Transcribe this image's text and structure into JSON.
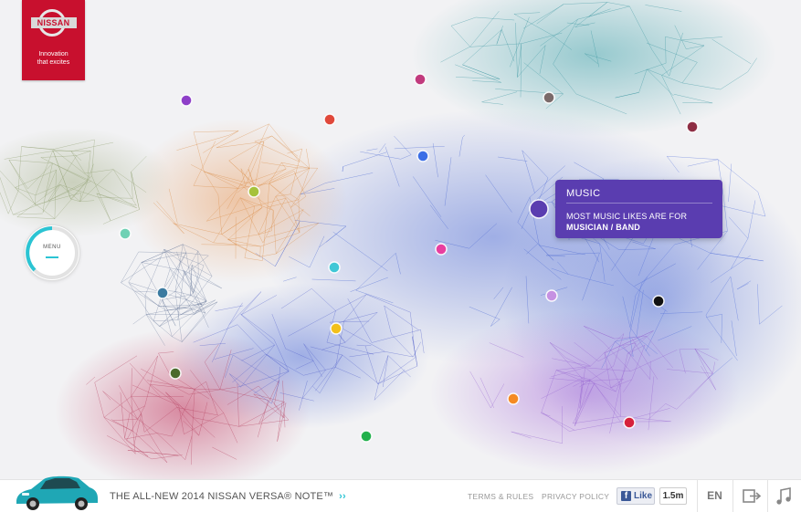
{
  "brand": {
    "name": "NISSAN",
    "tagline_line1": "Innovation",
    "tagline_line2": "that excites",
    "color": "#c8102e"
  },
  "menu": {
    "label": "MENU",
    "accent": "#2bc4d3"
  },
  "tooltip": {
    "title": "MUSIC",
    "line1": "MOST MUSIC LIKES ARE FOR",
    "line2": "MUSICIAN / BAND",
    "color": "#5a3db0"
  },
  "nodes": [
    {
      "name": "node-purple",
      "color": "#8e3fc8"
    },
    {
      "name": "node-red",
      "color": "#e0483a"
    },
    {
      "name": "node-magenta",
      "color": "#c13a7d"
    },
    {
      "name": "node-gray",
      "color": "#7a6a6a"
    },
    {
      "name": "node-maroon",
      "color": "#8e2d43"
    },
    {
      "name": "node-blue",
      "color": "#3b6ee6"
    },
    {
      "name": "node-lime",
      "color": "#a6c23a"
    },
    {
      "name": "node-music",
      "color": "#5a3db0"
    },
    {
      "name": "node-mint",
      "color": "#6fd1b4"
    },
    {
      "name": "node-pink",
      "color": "#e83ea0"
    },
    {
      "name": "node-cyan",
      "color": "#3fc7d6"
    },
    {
      "name": "node-steel",
      "color": "#3a7aa0"
    },
    {
      "name": "node-lavender",
      "color": "#c691e2"
    },
    {
      "name": "node-black",
      "color": "#111111"
    },
    {
      "name": "node-yellow",
      "color": "#f2c01a"
    },
    {
      "name": "node-olive",
      "color": "#4b6a2c"
    },
    {
      "name": "node-orange",
      "color": "#f58a22"
    },
    {
      "name": "node-crimson",
      "color": "#d6203b"
    },
    {
      "name": "node-green",
      "color": "#22b14c"
    }
  ],
  "footer": {
    "promo": "THE ALL-NEW 2014 NISSAN VERSA® NOTE™",
    "promo_arrows": "››",
    "terms": "TERMS & RULES",
    "privacy": "PRIVACY POLICY",
    "fb_like": "Like",
    "fb_count": "1.5m",
    "language": "EN",
    "car_color": "#1fa7b5",
    "icons": [
      "exit-icon",
      "music-icon"
    ]
  }
}
